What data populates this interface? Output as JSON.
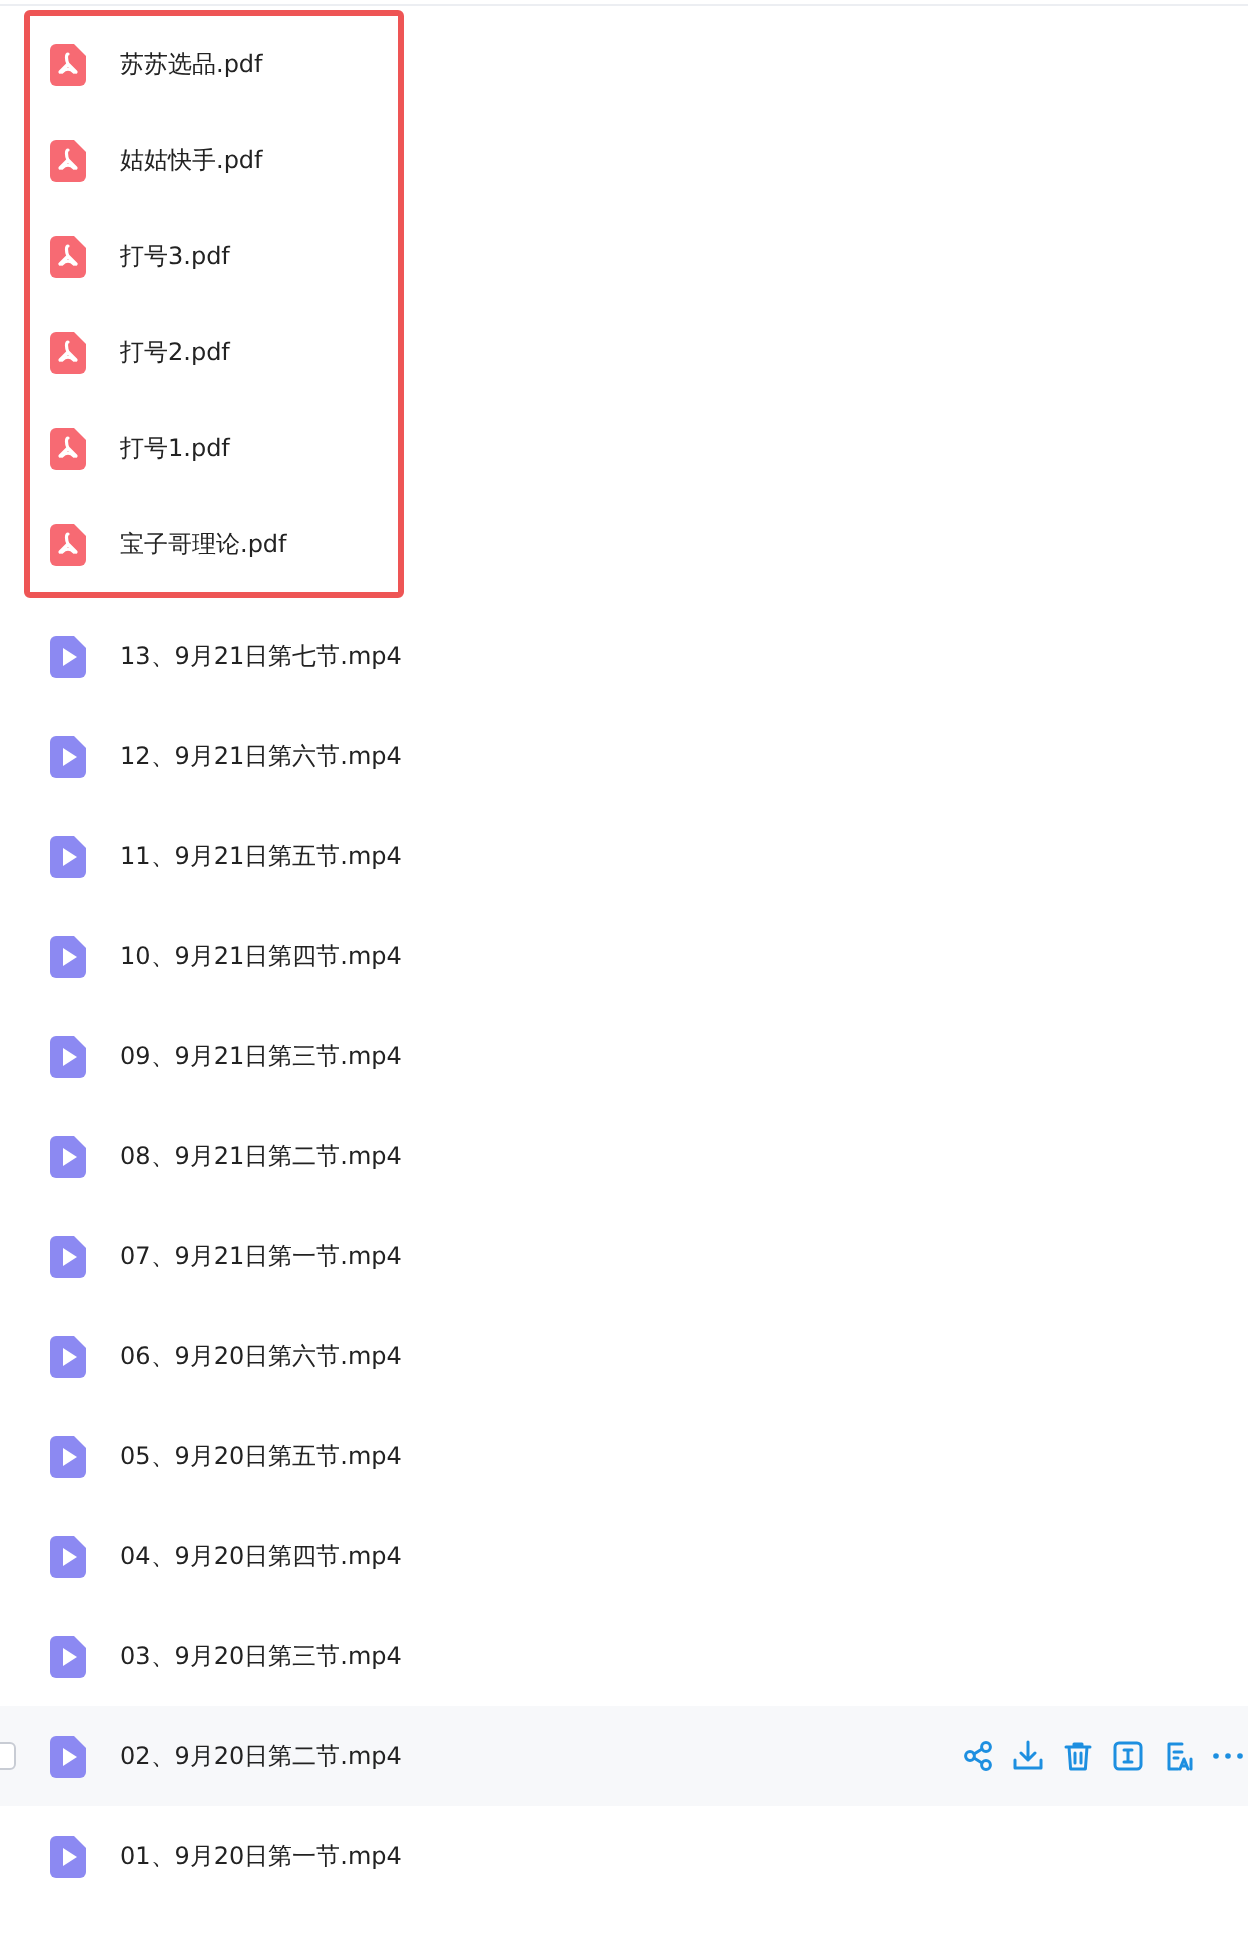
{
  "highlighted_files": [
    {
      "name": "苏苏选品.pdf",
      "kind": "pdf",
      "hovered": false
    },
    {
      "name": "姑姑快手.pdf",
      "kind": "pdf",
      "hovered": false
    },
    {
      "name": "打号3.pdf",
      "kind": "pdf",
      "hovered": false
    },
    {
      "name": "打号2.pdf",
      "kind": "pdf",
      "hovered": false
    },
    {
      "name": "打号1.pdf",
      "kind": "pdf",
      "hovered": false
    },
    {
      "name": "宝子哥理论.pdf",
      "kind": "pdf",
      "hovered": false
    }
  ],
  "files": [
    {
      "name": "13、9月21日第七节.mp4",
      "kind": "video",
      "hovered": false
    },
    {
      "name": "12、9月21日第六节.mp4",
      "kind": "video",
      "hovered": false
    },
    {
      "name": "11、9月21日第五节.mp4",
      "kind": "video",
      "hovered": false
    },
    {
      "name": "10、9月21日第四节.mp4",
      "kind": "video",
      "hovered": false
    },
    {
      "name": "09、9月21日第三节.mp4",
      "kind": "video",
      "hovered": false
    },
    {
      "name": "08、9月21日第二节.mp4",
      "kind": "video",
      "hovered": false
    },
    {
      "name": "07、9月21日第一节.mp4",
      "kind": "video",
      "hovered": false
    },
    {
      "name": "06、9月20日第六节.mp4",
      "kind": "video",
      "hovered": false
    },
    {
      "name": "05、9月20日第五节.mp4",
      "kind": "video",
      "hovered": false
    },
    {
      "name": "04、9月20日第四节.mp4",
      "kind": "video",
      "hovered": false
    },
    {
      "name": "03、9月20日第三节.mp4",
      "kind": "video",
      "hovered": false
    },
    {
      "name": "02、9月20日第二节.mp4",
      "kind": "video",
      "hovered": true
    },
    {
      "name": "01、9月20日第一节.mp4",
      "kind": "video",
      "hovered": false
    }
  ]
}
